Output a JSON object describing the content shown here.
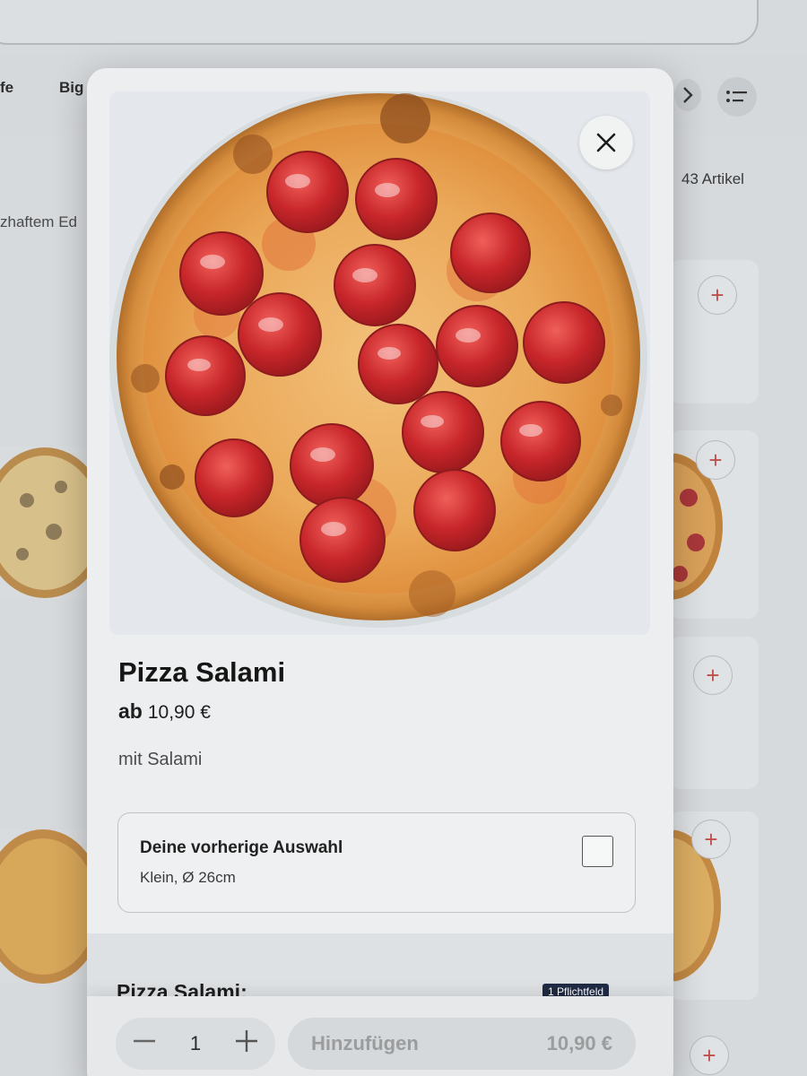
{
  "background": {
    "categories": [
      "fe",
      "Big"
    ],
    "article_count": "43 Artikel",
    "desc_fragment": "zhaftem Ed",
    "add_symbol": "+"
  },
  "modal": {
    "product": {
      "name": "Pizza Salami",
      "price_prefix": "ab",
      "price": "10,90 €",
      "description": "mit Salami"
    },
    "previous_selection": {
      "title": "Deine vorherige Auswahl",
      "detail": "Klein, Ø 26cm",
      "checked": false
    },
    "options_section": {
      "title": "Pizza Salami:",
      "required_badge": "1 Pflichtfeld"
    },
    "footer": {
      "quantity": "1",
      "minus_symbol": "—",
      "plus_symbol": "+",
      "add_label": "Hinzufügen",
      "total": "10,90 €"
    }
  },
  "colors": {
    "accent_plus": "#c0504d",
    "badge_bg": "#1f2a44"
  },
  "icons": [
    "close-icon",
    "chevron-right-icon",
    "sort-icon",
    "plus-icon",
    "minus-icon"
  ]
}
